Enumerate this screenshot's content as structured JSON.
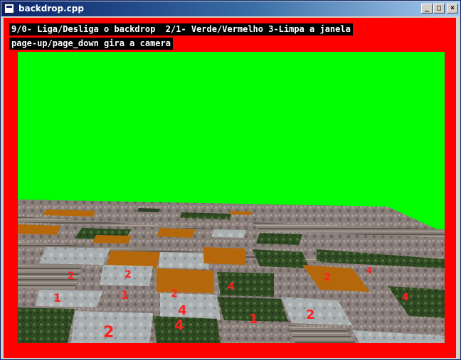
{
  "window": {
    "title": "backdrop.cpp",
    "buttons": {
      "minimize": "_",
      "maximize": "□",
      "close": "×"
    }
  },
  "hud": {
    "line1": "9/0- Liga/Desliga o backdrop  2/1- Verde/Vermelho 3-Limpa a janela",
    "line2": "page-up/page_down gira a camera"
  },
  "colors": {
    "backdrop": "#00ff00",
    "clear_color": "#ff0000",
    "tile_labels": "#ff2020"
  },
  "floor": {
    "tile_labels": [
      "2",
      "2",
      "4",
      "4",
      "2",
      "4",
      "1",
      "2",
      "1",
      "1",
      "2",
      "2",
      "4",
      "4"
    ]
  }
}
